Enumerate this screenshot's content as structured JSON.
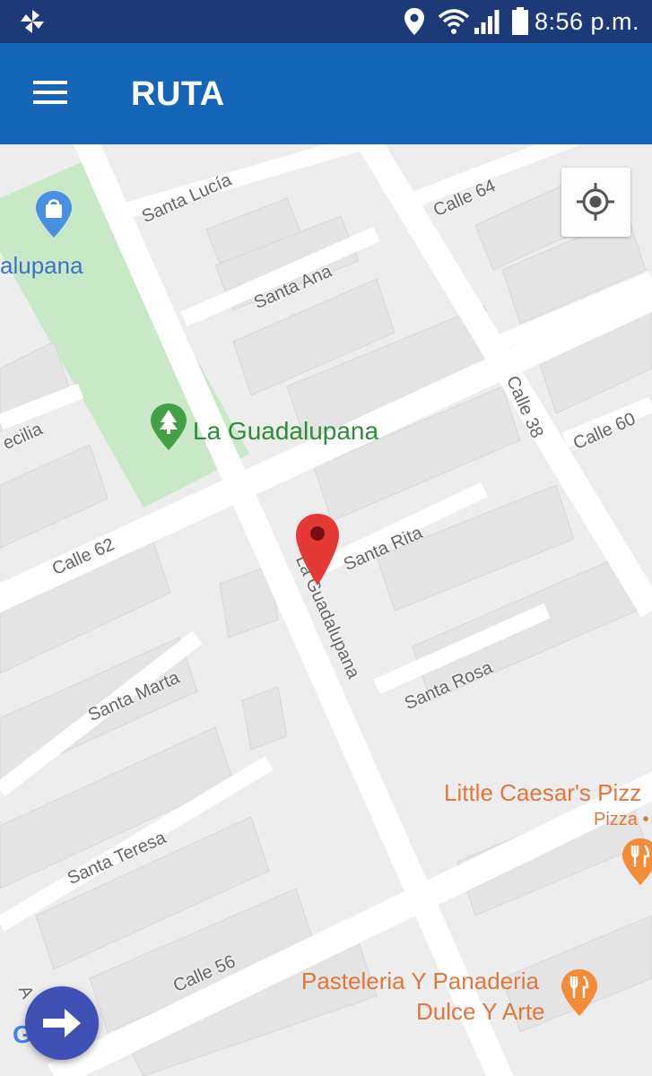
{
  "status_bar": {
    "time": "8:56 p.m.",
    "icons": [
      "pinwheel-icon",
      "location-icon",
      "wifi-icon",
      "signal-icon",
      "battery-icon"
    ]
  },
  "app_bar": {
    "title": "RUTA",
    "menu_icon": "hamburger-icon",
    "color": "#1565b8"
  },
  "map": {
    "streets": {
      "santa_lucia": "Santa Lucía",
      "calle_64": "Calle 64",
      "santa_ana": "Santa Ana",
      "calle_38": "Calle 38",
      "calle_60": "Calle 60",
      "cecilia": "ecilia",
      "calle_62": "Calle 62",
      "santa_rita": "Santa Rita",
      "la_guadalupana_street": "La Guadalupana",
      "santa_marta": "Santa Marta",
      "santa_rosa": "Santa Rosa",
      "santa_teresa": "Santa Teresa",
      "calle_56": "Calle 56",
      "a_partial": "A"
    },
    "pois": {
      "shop_partial": "alupana",
      "park": "La Guadalupana",
      "little_caesars": "Little Caesar's Pizz",
      "little_caesars_category": "Pizza •",
      "pasteleria_line1": "Pasteleria Y Panaderia",
      "pasteleria_line2": "Dulce Y Arte"
    },
    "google_logo_partial": "G e",
    "colors": {
      "park": "#c8e8c8",
      "park_text": "#2e8b3a",
      "restaurant": "#e2773a",
      "shop_text": "#3b74c4",
      "marker": "#e53935"
    }
  },
  "controls": {
    "locate_icon": "my-location-icon",
    "fab_icon": "arrow-right-icon"
  }
}
